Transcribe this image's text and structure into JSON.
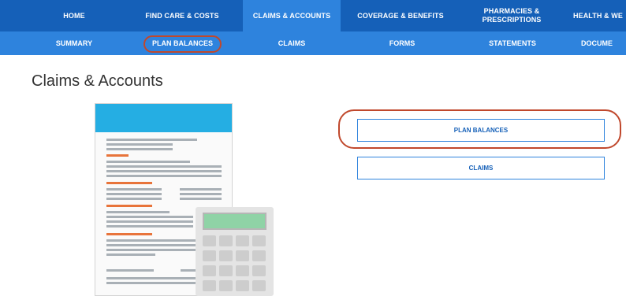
{
  "nav": {
    "primary": [
      "HOME",
      "FIND CARE & COSTS",
      "CLAIMS & ACCOUNTS",
      "COVERAGE & BENEFITS",
      "PHARMACIES &\nPRESCRIPTIONS",
      "HEALTH & WE"
    ],
    "secondary": [
      "SUMMARY",
      "PLAN BALANCES",
      "CLAIMS",
      "FORMS",
      "STATEMENTS",
      "DOCUME"
    ]
  },
  "page": {
    "title": "Claims & Accounts"
  },
  "buttons": {
    "plan_balances": "PLAN BALANCES",
    "claims": "CLAIMS"
  },
  "colors": {
    "nav_primary": "#1560b8",
    "nav_active": "#2e83dd",
    "highlight_circle": "#c0482c",
    "doc_header": "#25aee3"
  }
}
